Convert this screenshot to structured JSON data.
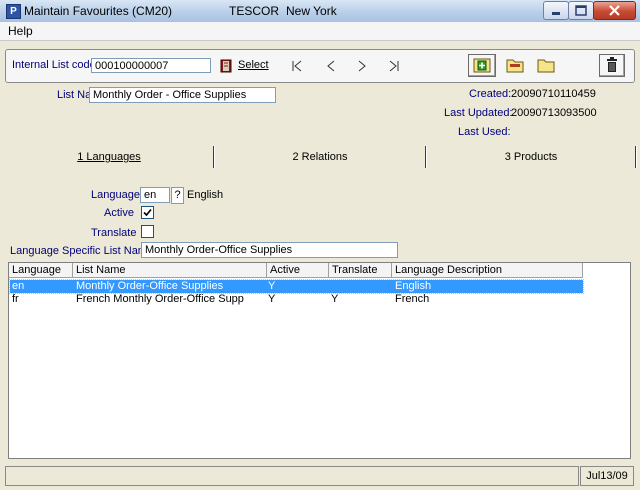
{
  "window": {
    "title": "Maintain Favourites (CM20)",
    "company": "TESCOR",
    "city": "New York"
  },
  "menu": {
    "help": "Help"
  },
  "toolbar": {
    "internal_list_code_label": "Internal List code",
    "internal_list_code_value": "000100000007",
    "select_label": "Select"
  },
  "header": {
    "list_name_label": "List Name",
    "list_name_value": "Monthly Order - Office Supplies",
    "created_label": "Created:",
    "created_value": "20090710110459",
    "last_updated_label": "Last Updated:",
    "last_updated_value": "20090713093500",
    "last_used_label": "Last Used:",
    "last_used_value": ""
  },
  "tabs": [
    {
      "label": "1 Languages"
    },
    {
      "label": "2 Relations"
    },
    {
      "label": "3 Products"
    }
  ],
  "form": {
    "language_label": "Language",
    "language_code": "en",
    "language_lookup": "?",
    "language_name": "English",
    "active_label": "Active",
    "active_checked": true,
    "translate_label": "Translate",
    "translate_checked": false,
    "specific_name_label": "Language Specific List Name",
    "specific_name_value": "Monthly Order-Office Supplies"
  },
  "grid": {
    "columns": [
      "Language",
      "List Name",
      "Active",
      "Translate",
      "Language Description"
    ],
    "rows": [
      {
        "language": "en",
        "list_name": "Monthly Order-Office Supplies",
        "active": "Y",
        "translate": "",
        "description": "English",
        "selected": true
      },
      {
        "language": "fr",
        "list_name": "French Monthly Order-Office Supp",
        "active": "Y",
        "translate": "Y",
        "description": "French",
        "selected": false
      }
    ]
  },
  "status": {
    "date": "Jul13/09"
  },
  "icons": {
    "app": "app-icon",
    "select": "book-icon",
    "first": "first-record-icon",
    "prev": "previous-record-icon",
    "next": "next-record-icon",
    "last": "last-record-icon",
    "add": "add-folder-icon",
    "edit": "edit-folder-icon",
    "open": "open-folder-icon",
    "delete": "trash-icon"
  },
  "colors": {
    "label_blue": "#00007a",
    "selection": "#3399ff",
    "window_bg": "#ece9d8"
  }
}
